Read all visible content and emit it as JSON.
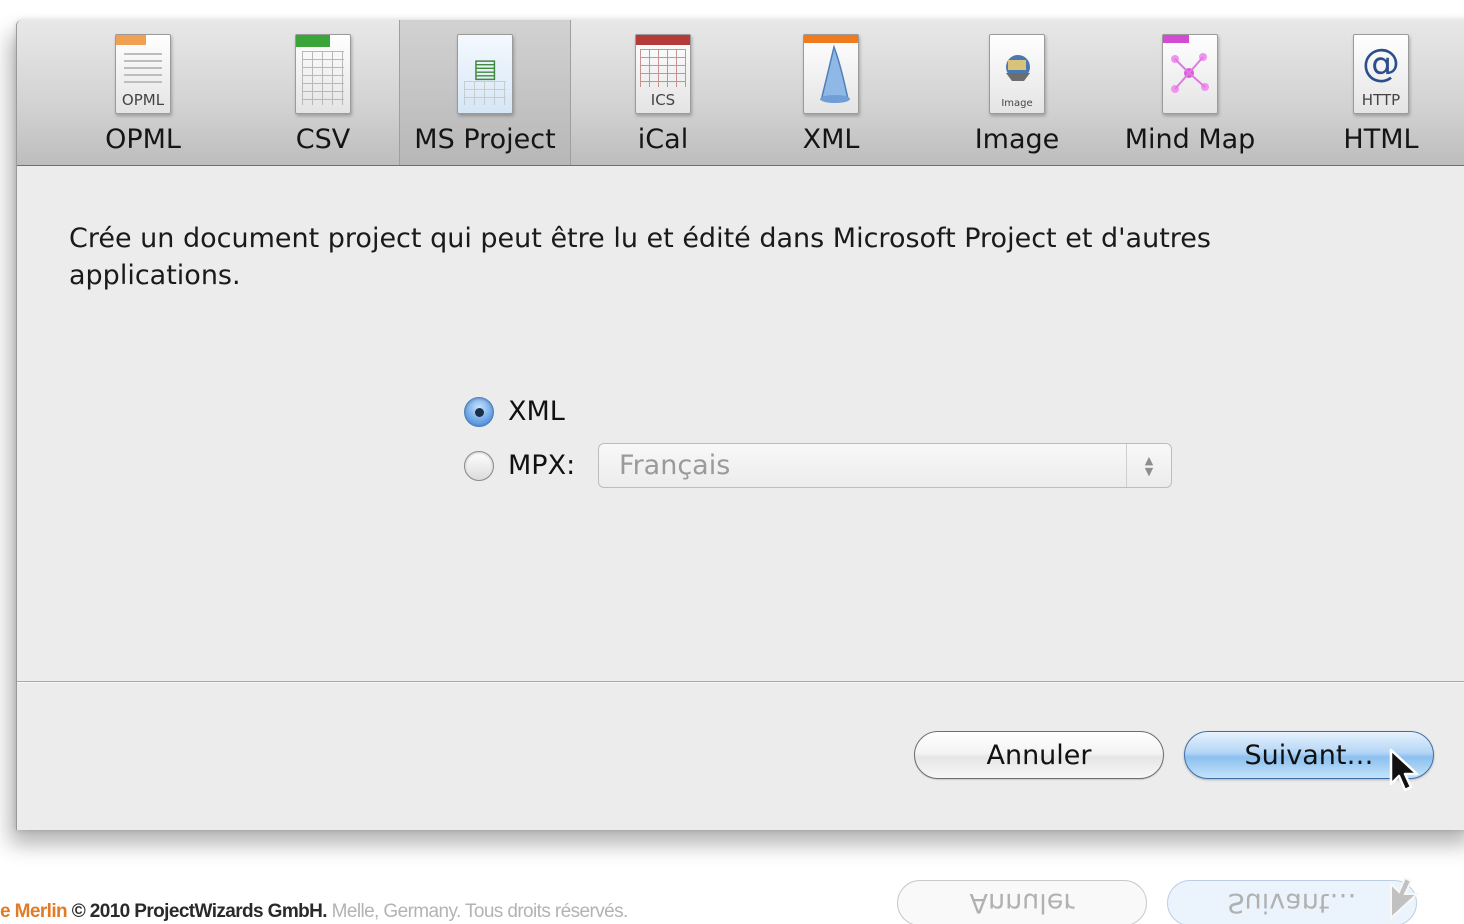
{
  "toolbar": {
    "items": [
      {
        "label": "OPML",
        "icon": "opml-file-icon",
        "caption": "OPML",
        "selected": false
      },
      {
        "label": "CSV",
        "icon": "csv-file-icon",
        "caption": "",
        "selected": false
      },
      {
        "label": "MS Project",
        "icon": "ms-project-file-icon",
        "caption": "",
        "selected": true
      },
      {
        "label": "iCal",
        "icon": "ical-file-icon",
        "caption": "ICS",
        "selected": false
      },
      {
        "label": "XML",
        "icon": "xml-file-icon",
        "caption": "",
        "selected": false
      },
      {
        "label": "Image",
        "icon": "image-file-icon",
        "caption": "Image",
        "selected": false
      },
      {
        "label": "Mind Map",
        "icon": "mind-map-file-icon",
        "caption": "",
        "selected": false
      },
      {
        "label": "HTML",
        "icon": "html-file-icon",
        "caption": "HTTP",
        "selected": false
      }
    ]
  },
  "main": {
    "description": "Crée un document project qui peut être lu et édité dans Microsoft Project et d'autres applications.",
    "options": {
      "xml_label": "XML",
      "xml_checked": true,
      "mpx_label": "MPX:",
      "mpx_checked": false,
      "mpx_language": "Français"
    }
  },
  "buttons": {
    "cancel_label": "Annuler",
    "next_label": "Suivant…"
  },
  "footer": {
    "brand": "e Merlin",
    "copyright": "© 2010 ProjectWizards GmbH.",
    "place": "Melle, Germany. Tous droits réservés."
  },
  "colors": {
    "accent_button": "#8cc0ef",
    "brand_orange": "#e07b26"
  }
}
